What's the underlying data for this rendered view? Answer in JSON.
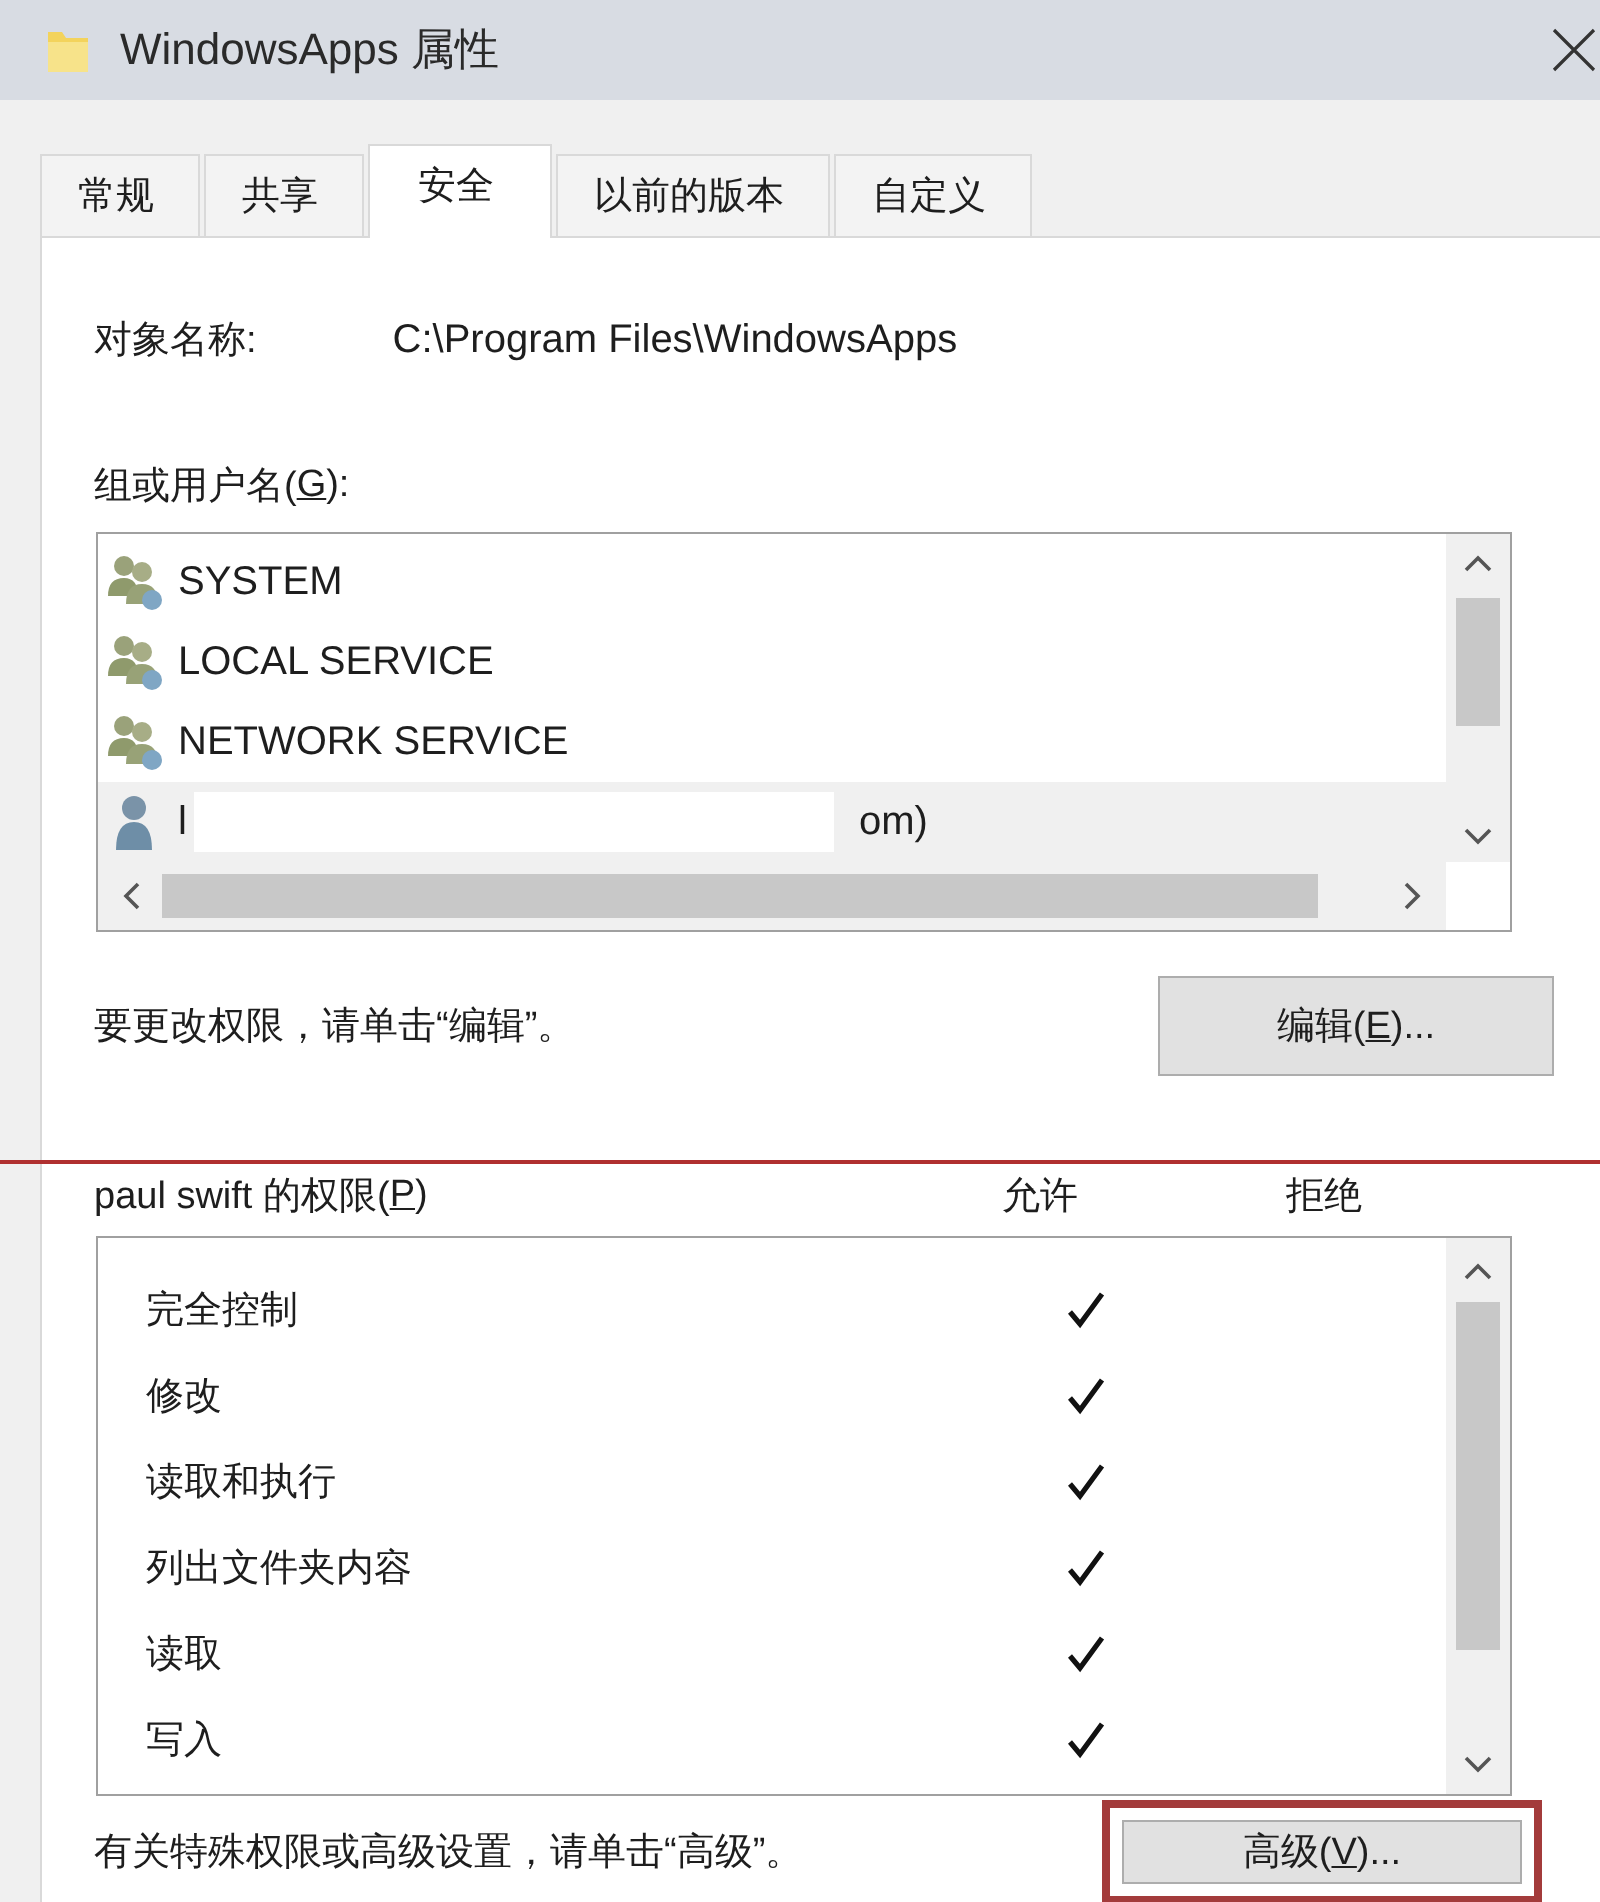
{
  "window": {
    "title": "WindowsApps 属性"
  },
  "tabs": [
    {
      "label": "常规",
      "selected": false
    },
    {
      "label": "共享",
      "selected": false
    },
    {
      "label": "安全",
      "selected": true
    },
    {
      "label": "以前的版本",
      "selected": false
    },
    {
      "label": "自定义",
      "selected": false
    }
  ],
  "object_name": {
    "label": "对象名称:",
    "value": "C:\\Program Files\\WindowsApps"
  },
  "groups": {
    "label": "组或用户名(G):",
    "key_underlined": true,
    "items": [
      {
        "kind": "group",
        "name": "SYSTEM",
        "selected": false
      },
      {
        "kind": "group",
        "name": "LOCAL SERVICE",
        "selected": false
      },
      {
        "kind": "group",
        "name": "NETWORK SERVICE",
        "selected": false
      },
      {
        "kind": "user",
        "name": "l",
        "name_end": "om)",
        "redacted": true,
        "selected": true
      }
    ]
  },
  "edit_hint": "要更改权限，请单击“编辑”。",
  "edit_button": {
    "label": "编辑(E)...",
    "key_underlined": true
  },
  "permissions": {
    "label": "paul swift 的权限(P)",
    "key_underlined": true,
    "annotated": true,
    "columns": [
      "允许",
      "拒绝"
    ],
    "rows": [
      {
        "name": "完全控制",
        "allow": true,
        "deny": false
      },
      {
        "name": "修改",
        "allow": true,
        "deny": false
      },
      {
        "name": "读取和执行",
        "allow": true,
        "deny": false
      },
      {
        "name": "列出文件夹内容",
        "allow": true,
        "deny": false
      },
      {
        "name": "读取",
        "allow": true,
        "deny": false
      },
      {
        "name": "写入",
        "allow": true,
        "deny": false
      }
    ]
  },
  "advanced_hint": "有关特殊权限或高级设置，请单击“高级”。",
  "advanced_button": {
    "label": "高级(V)...",
    "key_underlined": true,
    "highlighted": true
  }
}
